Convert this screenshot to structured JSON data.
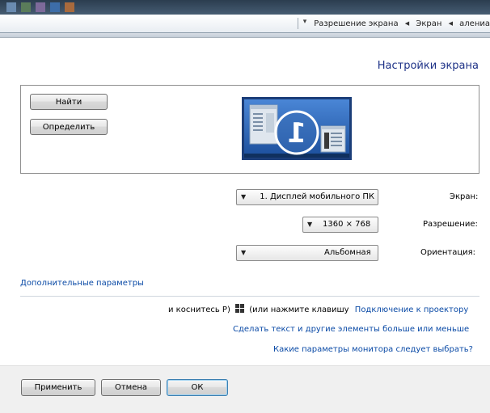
{
  "breadcrumb": {
    "items": [
      "Разрешение экрана",
      "Экран",
      "алениа"
    ]
  },
  "heading": "Настройки экрана",
  "monitor_panel": {
    "detect_label": "Найти",
    "identify_label": "Определить",
    "monitor_number": "1"
  },
  "form": {
    "display": {
      "label": "Экран:",
      "value": "1. Дисплей мобильного ПК"
    },
    "resolution": {
      "label": "Разрешение:",
      "value": "1360 × 768"
    },
    "orientation": {
      "label": "Ориентация:",
      "value": "Альбомная"
    }
  },
  "links": {
    "advanced": "Дополнительные параметры",
    "projector_link": "Подключение к проектору",
    "projector_hint_pre": "(или нажмите клавишу",
    "projector_hint_post": "и коснитесь P)",
    "text_size": "Сделать текст и другие элементы больше или меньше",
    "which_settings": "Какие параметры монитора следует выбрать?"
  },
  "buttons": {
    "ok": "ОК",
    "cancel": "Отмена",
    "apply": "Применить"
  },
  "colors": {
    "link": "#0a4aa6",
    "heading": "#1e3287",
    "monitor_blue": "#2f5fb0"
  }
}
